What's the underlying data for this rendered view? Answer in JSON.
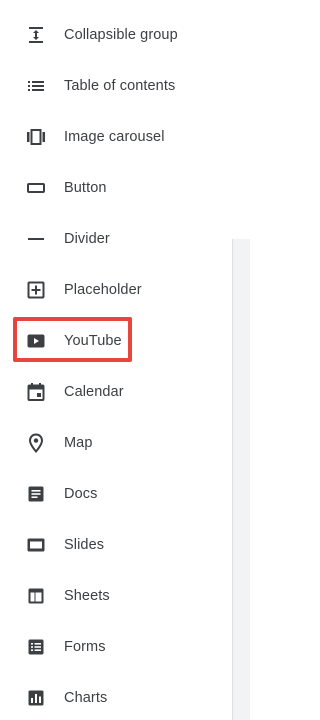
{
  "menu": {
    "items": [
      {
        "label": "Collapsible group",
        "icon": "collapsible-group-icon"
      },
      {
        "label": "Table of contents",
        "icon": "table-of-contents-icon"
      },
      {
        "label": "Image carousel",
        "icon": "image-carousel-icon"
      },
      {
        "label": "Button",
        "icon": "button-icon"
      },
      {
        "label": "Divider",
        "icon": "divider-icon"
      },
      {
        "label": "Placeholder",
        "icon": "placeholder-icon"
      },
      {
        "label": "YouTube",
        "icon": "youtube-icon"
      },
      {
        "label": "Calendar",
        "icon": "calendar-icon"
      },
      {
        "label": "Map",
        "icon": "map-pin-icon"
      },
      {
        "label": "Docs",
        "icon": "docs-icon"
      },
      {
        "label": "Slides",
        "icon": "slides-icon"
      },
      {
        "label": "Sheets",
        "icon": "sheets-icon"
      },
      {
        "label": "Forms",
        "icon": "forms-icon"
      },
      {
        "label": "Charts",
        "icon": "charts-icon"
      }
    ],
    "highlighted_item": "YouTube"
  },
  "colors": {
    "text": "#3c4043",
    "icon": "#3c4043",
    "highlight_border": "#e8453c",
    "scrollbar_thumb": "#f1f3f4"
  }
}
